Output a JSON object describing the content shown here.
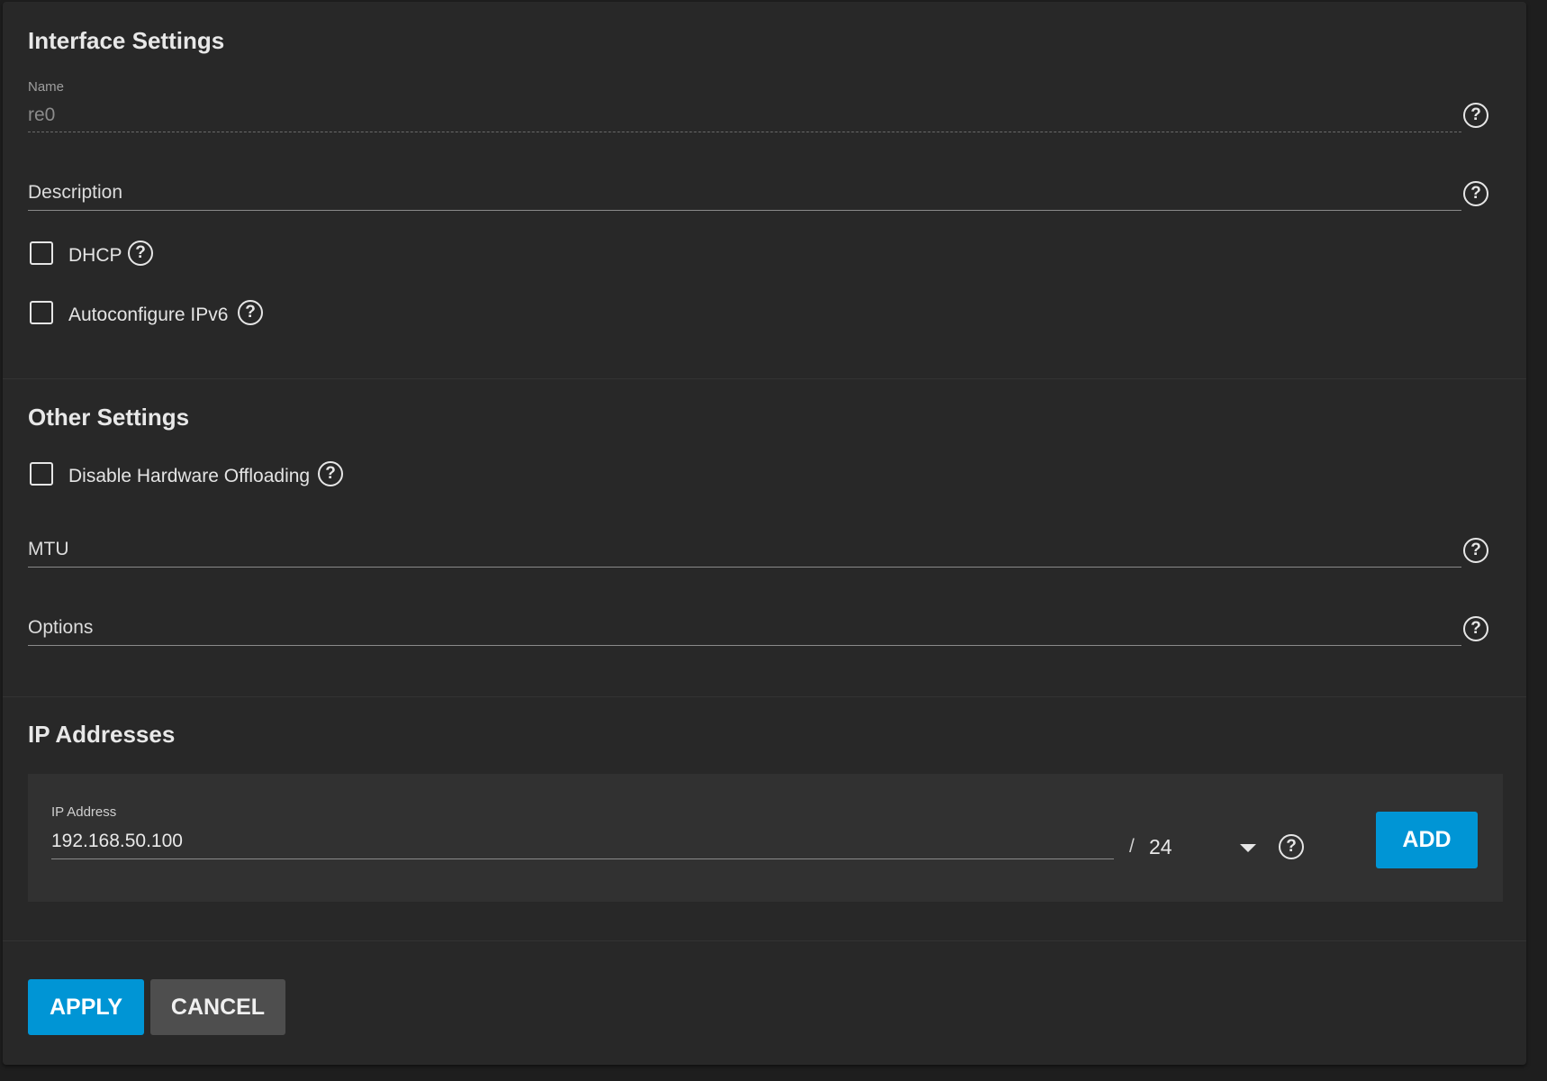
{
  "interface_settings": {
    "title": "Interface Settings",
    "name_label": "Name",
    "name_value": "re0",
    "description_placeholder": "Description",
    "dhcp_label": "DHCP",
    "dhcp_checked": false,
    "autoconfig_label": "Autoconfigure IPv6",
    "autoconfig_checked": false
  },
  "other_settings": {
    "title": "Other Settings",
    "disable_offloading_label": "Disable Hardware Offloading",
    "disable_offloading_checked": false,
    "mtu_placeholder": "MTU",
    "options_placeholder": "Options"
  },
  "ip_addresses": {
    "title": "IP Addresses",
    "ip_label": "IP Address",
    "ip_value": "192.168.50.100",
    "separator": "/",
    "netmask_value": "24",
    "add_label": "ADD"
  },
  "actions": {
    "apply_label": "APPLY",
    "cancel_label": "CANCEL"
  },
  "help_glyph": "?",
  "colors": {
    "primary": "#0095d5",
    "panel_bg": "#282828",
    "page_bg": "#1e1e1e"
  }
}
